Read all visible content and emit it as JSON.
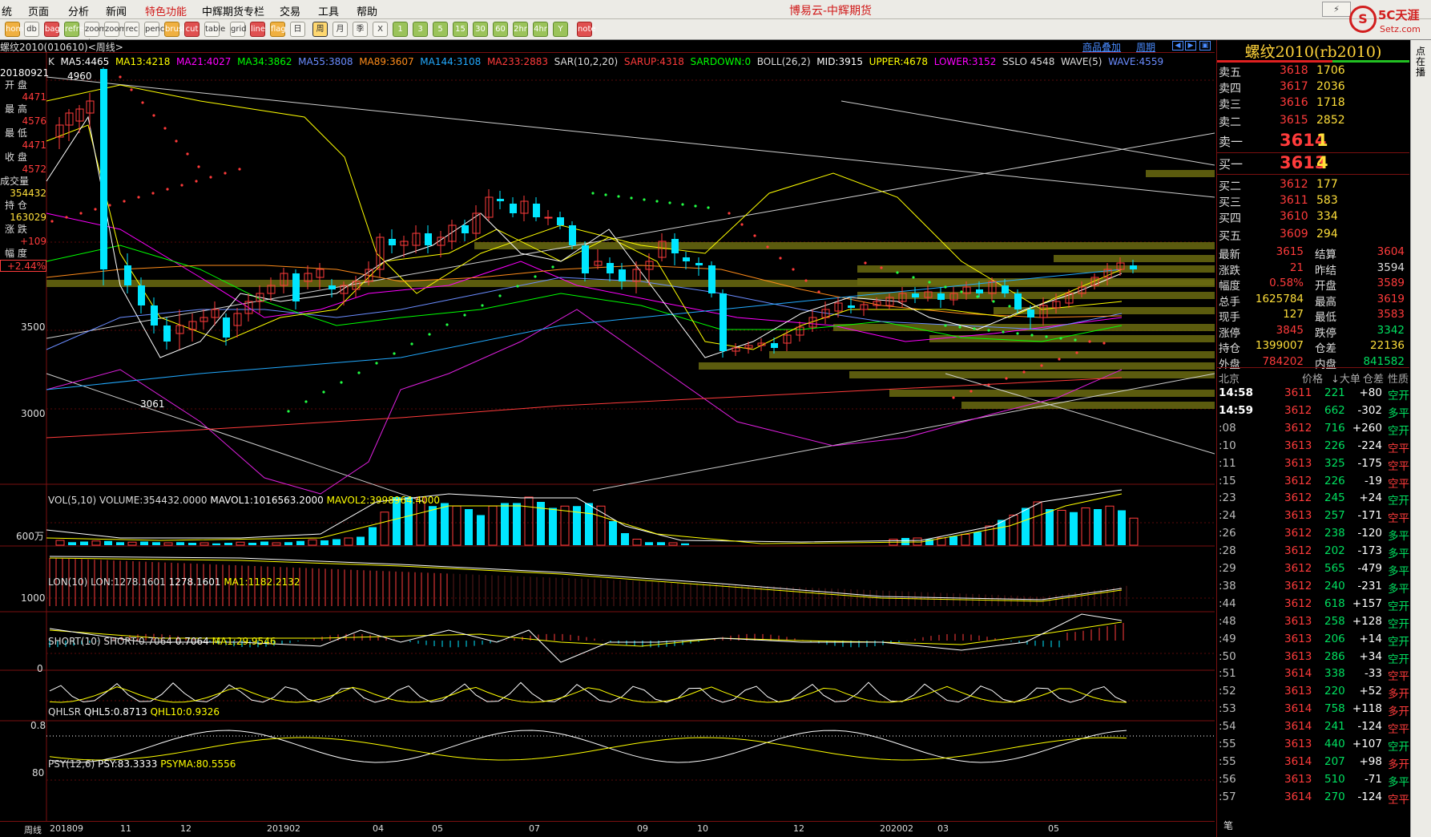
{
  "menu": [
    "统",
    "页面",
    "分析",
    "新闻",
    "特色功能",
    "中辉期货专栏",
    "交易",
    "工具",
    "帮助"
  ],
  "app_title": "博易云-中辉期货",
  "window_buttons": [
    "⚡",
    "□",
    "✕"
  ],
  "logo": {
    "text": "5C天涯",
    "sub": "Setz.com",
    "mark": "S"
  },
  "toolbar_icons": [
    "home",
    "db",
    "bag",
    "refresh",
    "zoom-in",
    "zoom-out",
    "rec",
    "pencil",
    "brush",
    "cut",
    "table",
    "grid",
    "line",
    "flag",
    "日",
    "周",
    "月",
    "季",
    "X",
    "1",
    "3",
    "5",
    "15",
    "30",
    "60",
    "2hr",
    "4hr",
    "Y",
    "note"
  ],
  "subbar": {
    "left": "螺纹2010(010610)<周线>",
    "overlay": "商品叠加",
    "period": "周期"
  },
  "main_indicator": {
    "k": "K",
    "ma5": "MA5:4465",
    "ma13": "MA13:4218",
    "ma21": "MA21:4027",
    "ma34": "MA34:3862",
    "ma55": "MA55:3808",
    "ma89": "MA89:3607",
    "ma144": "MA144:3108",
    "ma233": "MA233:2883",
    "sar": "SAR(10,2,20)",
    "sarup": "SARUP:4318",
    "sardown": "SARDOWN:0",
    "boll": "BOLL(26,2)",
    "mid": "MID:3915",
    "upper": "UPPER:4678",
    "lower": "LOWER:3152",
    "sslo": "SSLO 4548",
    "wave": "WAVE(5)",
    "wave2": "WAVE:4559"
  },
  "price_axis": {
    "p3500": "3500",
    "p3000": "3000",
    "hi": "4960",
    "lo": "3061"
  },
  "info_box": {
    "date": "20180921",
    "open_l": "开 盘",
    "open": "4471",
    "high_l": "最 高",
    "high": "4576",
    "low_l": "最 低",
    "low": "4471",
    "close_l": "收 盘",
    "close": "4572",
    "vol_l": "成交量",
    "vol": "354432",
    "oi_l": "持 仓",
    "oi": "163029",
    "chg_l": "涨 跌",
    "chg": "+109",
    "pct_l": "幅 度",
    "pct": "+2.44%"
  },
  "vol_panel": {
    "title": "VOL(5,10)",
    "volume": "VOLUME:354432.0000",
    "mavol1": "MAVOL1:1016563.2000",
    "mavol2": "MAVOL2:3998964.4000",
    "axis": "600万"
  },
  "lon_panel": {
    "title": "LON(10)",
    "lon": "LON:1278.1601",
    "v": "1278.1601",
    "ma1": "MA1:1182.2132",
    "axis": "1000"
  },
  "short_panel": {
    "title": "SHORT(10)",
    "short": "SHORT:0.7064",
    "v": "0.7064",
    "ma1": "MA1:29.9546",
    "axis": "0"
  },
  "qhlsr_panel": {
    "title": "QHLSR",
    "q5": "QHL5:0.8713",
    "q10": "QHL10:0.9326",
    "axis": "0.8"
  },
  "psy_panel": {
    "title": "PSY(12,6)",
    "psy": "PSY:83.3333",
    "psyma": "PSYMA:80.5556",
    "axis": "80"
  },
  "x_axis": [
    "周线",
    "201809",
    "11",
    "12",
    "201902",
    "04",
    "05",
    "07",
    "09",
    "10",
    "12",
    "202002",
    "03",
    "05"
  ],
  "right_panel": {
    "title": "螺纹2010(rb2010)",
    "asks": [
      {
        "l": "卖五",
        "p": "3618",
        "v": "1706"
      },
      {
        "l": "卖四",
        "p": "3617",
        "v": "2036"
      },
      {
        "l": "卖三",
        "p": "3616",
        "v": "1718"
      },
      {
        "l": "卖二",
        "p": "3615",
        "v": "2852"
      },
      {
        "l": "卖一",
        "p": "3614",
        "v": "1"
      }
    ],
    "bids": [
      {
        "l": "买一",
        "p": "3613",
        "v": "4"
      },
      {
        "l": "买二",
        "p": "3612",
        "v": "177"
      },
      {
        "l": "买三",
        "p": "3611",
        "v": "583"
      },
      {
        "l": "买四",
        "p": "3610",
        "v": "334"
      },
      {
        "l": "买五",
        "p": "3609",
        "v": "294"
      }
    ],
    "stats": [
      {
        "a": "最新",
        "av": "3615",
        "b": "结算",
        "bv": "3604"
      },
      {
        "a": "涨跌",
        "av": "21",
        "b": "昨结",
        "bv": "3594"
      },
      {
        "a": "幅度",
        "av": "0.58%",
        "b": "开盘",
        "bv": "3589"
      },
      {
        "a": "总手",
        "av": "1625784",
        "b": "最高",
        "bv": "3619"
      },
      {
        "a": "现手",
        "av": "127",
        "b": "最低",
        "bv": "3583"
      },
      {
        "a": "涨停",
        "av": "3845",
        "b": "跌停",
        "bv": "3342"
      },
      {
        "a": "持仓",
        "av": "1399007",
        "b": "仓差",
        "bv": "22136"
      },
      {
        "a": "外盘",
        "av": "784202",
        "b": "内盘",
        "bv": "841582"
      }
    ],
    "tick_header": {
      "t": "北京",
      "p": "价格",
      "v": "↓大单",
      "d": "仓差",
      "n": "性质"
    },
    "ticks": [
      {
        "t": "14:58",
        "p": "3611",
        "v": "221",
        "d": "+80",
        "n": "空开"
      },
      {
        "t": "14:59",
        "p": "3612",
        "v": "662",
        "d": "-302",
        "n": "多平"
      },
      {
        "t": ":08",
        "p": "3612",
        "v": "716",
        "d": "+260",
        "n": "空开"
      },
      {
        "t": ":10",
        "p": "3613",
        "v": "226",
        "d": "-224",
        "n": "空平"
      },
      {
        "t": ":11",
        "p": "3613",
        "v": "325",
        "d": "-175",
        "n": "空平"
      },
      {
        "t": ":15",
        "p": "3612",
        "v": "226",
        "d": "-19",
        "n": "空平"
      },
      {
        "t": ":23",
        "p": "3612",
        "v": "245",
        "d": "+24",
        "n": "空开"
      },
      {
        "t": ":24",
        "p": "3613",
        "v": "257",
        "d": "-171",
        "n": "空平"
      },
      {
        "t": ":26",
        "p": "3612",
        "v": "238",
        "d": "-120",
        "n": "多平"
      },
      {
        "t": ":28",
        "p": "3612",
        "v": "202",
        "d": "-173",
        "n": "多平"
      },
      {
        "t": ":29",
        "p": "3612",
        "v": "565",
        "d": "-479",
        "n": "多平"
      },
      {
        "t": ":38",
        "p": "3612",
        "v": "240",
        "d": "-231",
        "n": "多平"
      },
      {
        "t": ":44",
        "p": "3612",
        "v": "618",
        "d": "+157",
        "n": "空开"
      },
      {
        "t": ":48",
        "p": "3613",
        "v": "258",
        "d": "+128",
        "n": "空开"
      },
      {
        "t": ":49",
        "p": "3613",
        "v": "206",
        "d": "+14",
        "n": "空开"
      },
      {
        "t": ":50",
        "p": "3613",
        "v": "286",
        "d": "+34",
        "n": "空开"
      },
      {
        "t": ":51",
        "p": "3614",
        "v": "338",
        "d": "-33",
        "n": "空平"
      },
      {
        "t": ":52",
        "p": "3613",
        "v": "220",
        "d": "+52",
        "n": "多开"
      },
      {
        "t": ":53",
        "p": "3614",
        "v": "758",
        "d": "+118",
        "n": "多开"
      },
      {
        "t": ":54",
        "p": "3614",
        "v": "241",
        "d": "-124",
        "n": "空平"
      },
      {
        "t": ":55",
        "p": "3613",
        "v": "440",
        "d": "+107",
        "n": "空开"
      },
      {
        "t": ":55",
        "p": "3614",
        "v": "207",
        "d": "+98",
        "n": "多开"
      },
      {
        "t": ":56",
        "p": "3613",
        "v": "510",
        "d": "-71",
        "n": "多平"
      },
      {
        "t": ":57",
        "p": "3614",
        "v": "270",
        "d": "-124",
        "n": "空平"
      }
    ],
    "footer": "笔"
  },
  "edge_text": "点在播",
  "colors": {
    "up": "#ff3b3b",
    "down": "#00e6ff",
    "ma5": "#ffffff",
    "ma13": "#ffff00",
    "ma21": "#ff00ff",
    "ma34": "#00ff00",
    "ma55": "#6a8cff",
    "ma89": "#ff8c1a",
    "ma144": "#22aaff",
    "ma233": "#ff3b3b",
    "boll": "#ffff00",
    "lower": "#e020e0"
  }
}
